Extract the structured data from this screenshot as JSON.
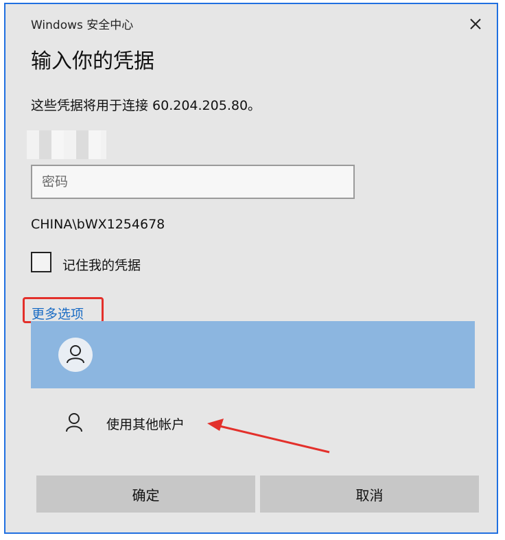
{
  "dialog": {
    "title": "Windows 安全中心",
    "heading": "输入你的凭据",
    "description": "这些凭据将用于连接 60.204.205.80。",
    "password_placeholder": "密码",
    "domain_user": "CHINA\\bWX1254678",
    "remember_label": "记住我的凭据",
    "more_options": "更多选项",
    "other_account": "使用其他帐户",
    "ok_label": "确定",
    "cancel_label": "取消"
  },
  "colors": {
    "selected_account_bg": "#8cb6e0",
    "link": "#1a6cc4",
    "annotation_red": "#e3302b"
  },
  "icons": {
    "close": "close-icon",
    "user": "user-icon"
  }
}
